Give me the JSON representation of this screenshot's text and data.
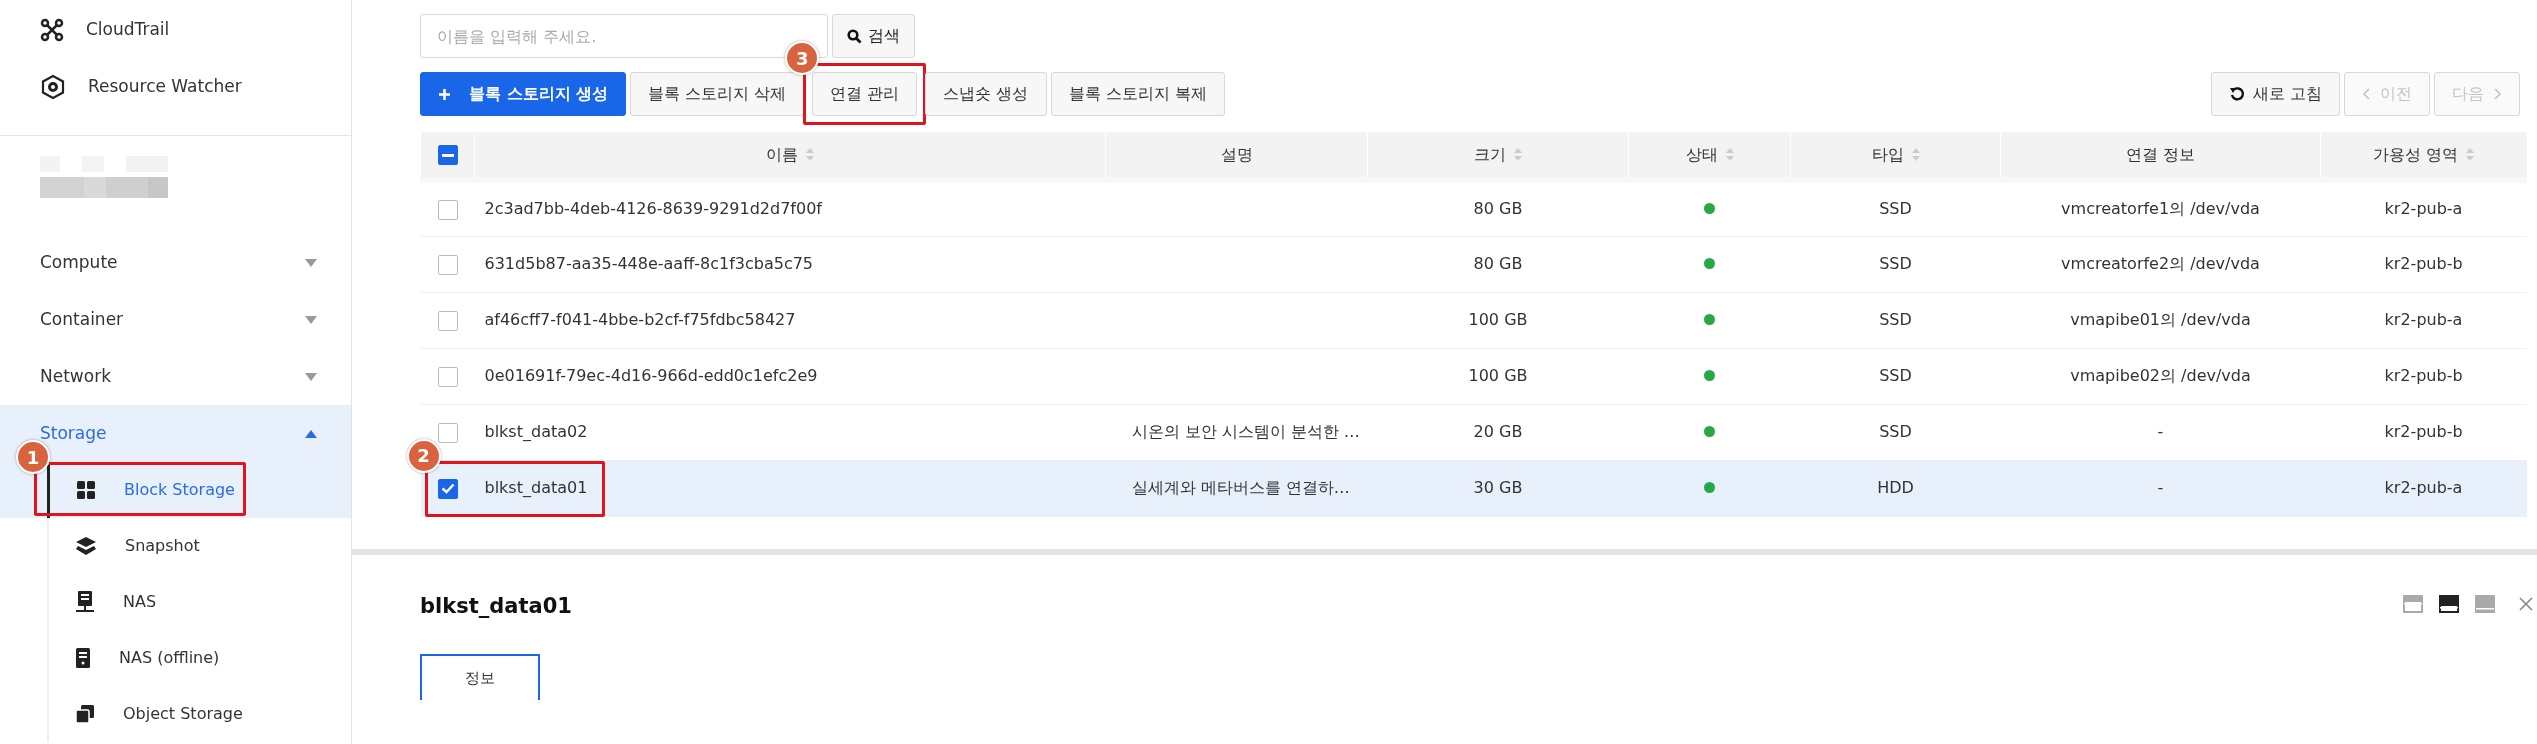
{
  "sidebar": {
    "top_items": [
      {
        "label": "CloudTrail"
      },
      {
        "label": "Resource Watcher"
      }
    ],
    "groups": [
      {
        "label": "Compute",
        "expanded": false
      },
      {
        "label": "Container",
        "expanded": false
      },
      {
        "label": "Network",
        "expanded": false
      },
      {
        "label": "Storage",
        "expanded": true,
        "children": [
          {
            "label": "Block Storage",
            "selected": true,
            "callout": "1"
          },
          {
            "label": "Snapshot",
            "selected": false
          },
          {
            "label": "NAS",
            "selected": false
          },
          {
            "label": "NAS (offline)",
            "selected": false
          },
          {
            "label": "Object Storage",
            "selected": false
          }
        ]
      }
    ]
  },
  "search": {
    "placeholder": "이름을 입력해 주세요.",
    "button": "검색"
  },
  "toolbar": [
    {
      "label": "블록 스토리지 생성",
      "kind": "primary"
    },
    {
      "label": "블록 스토리지 삭제",
      "kind": "default"
    },
    {
      "label": "연결 관리",
      "kind": "default",
      "callout": "3"
    },
    {
      "label": "스냅숏 생성",
      "kind": "default"
    },
    {
      "label": "블록 스토리지 복제",
      "kind": "default"
    }
  ],
  "pager": {
    "refresh": "새로 고침",
    "prev": {
      "label": "이전",
      "disabled": true
    },
    "next": {
      "label": "다음",
      "disabled": true
    }
  },
  "table": {
    "header_checkbox": {
      "indeterminate": true
    },
    "columns": [
      {
        "label": "이름",
        "sortable": true
      },
      {
        "label": "설명",
        "sortable": false
      },
      {
        "label": "크기",
        "sortable": true
      },
      {
        "label": "상태",
        "sortable": true
      },
      {
        "label": "타입",
        "sortable": true
      },
      {
        "label": "연결 정보",
        "sortable": false
      },
      {
        "label": "가용성 영역",
        "sortable": true
      }
    ],
    "rows": [
      {
        "checked": false,
        "selected": false,
        "name": "2c3ad7bb-4deb-4126-8639-9291d2d7f00f",
        "size": "80 GB",
        "type": "SSD",
        "connection": "vmcreatorfe1의 /dev/vda",
        "zone": "kr2-pub-a"
      },
      {
        "checked": false,
        "selected": false,
        "name": "631d5b87-aa35-448e-aaff-8c1f3cba5c75",
        "size": "80 GB",
        "type": "SSD",
        "connection": "vmcreatorfe2의 /dev/vda",
        "zone": "kr2-pub-b"
      },
      {
        "checked": false,
        "selected": false,
        "name": "af46cff7-f041-4bbe-b2cf-f75fdbc58427",
        "size": "100 GB",
        "type": "SSD",
        "connection": "vmapibe01의 /dev/vda",
        "zone": "kr2-pub-a"
      },
      {
        "checked": false,
        "selected": false,
        "name": "0e01691f-79ec-4d16-966d-edd0c1efc2e9",
        "size": "100 GB",
        "type": "SSD",
        "connection": "vmapibe02의 /dev/vda",
        "zone": "kr2-pub-b"
      },
      {
        "checked": false,
        "selected": false,
        "name": "blkst_data02",
        "description": "시온의 보안 시스템이 분석한 …",
        "size": "20 GB",
        "type": "SSD",
        "connection": "-",
        "zone": "kr2-pub-b"
      },
      {
        "checked": true,
        "selected": true,
        "callout": "2",
        "name": "blkst_data01",
        "description": "실세계와 메타버스를 연결하…",
        "size": "30 GB",
        "type": "HDD",
        "connection": "-",
        "zone": "kr2-pub-a"
      }
    ]
  },
  "detail": {
    "title": "blkst_data01",
    "layouts": [
      {
        "selected": false
      },
      {
        "selected": true
      },
      {
        "selected": false
      }
    ],
    "tabs": [
      {
        "label": "정보",
        "selected": true
      }
    ]
  }
}
